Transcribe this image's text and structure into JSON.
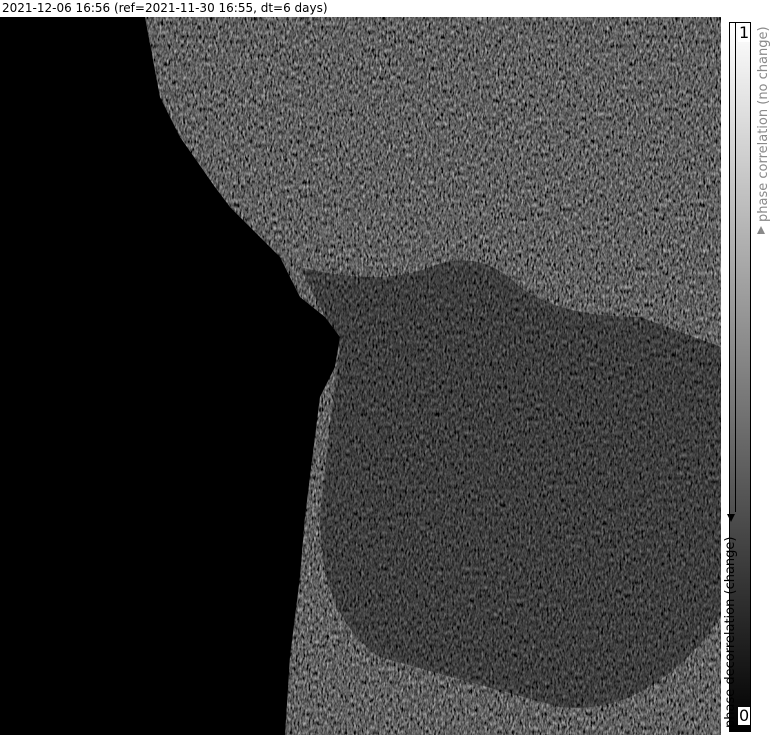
{
  "header": {
    "title": "2021-12-06 16:56 (ref=2021-11-30 16:55, dt=6 days)"
  },
  "colorbar": {
    "max_label": "1",
    "min_label": "0",
    "high_meaning": "phase correlation (no change)",
    "low_meaning": "phase decorrelation (change)"
  },
  "colors": {
    "background": "#000000",
    "no_change_label": "#8a8a8a",
    "change_label": "#000000"
  },
  "icons": {
    "up_arrow": "arrow-up-icon",
    "down_arrow": "arrow-down-icon"
  }
}
